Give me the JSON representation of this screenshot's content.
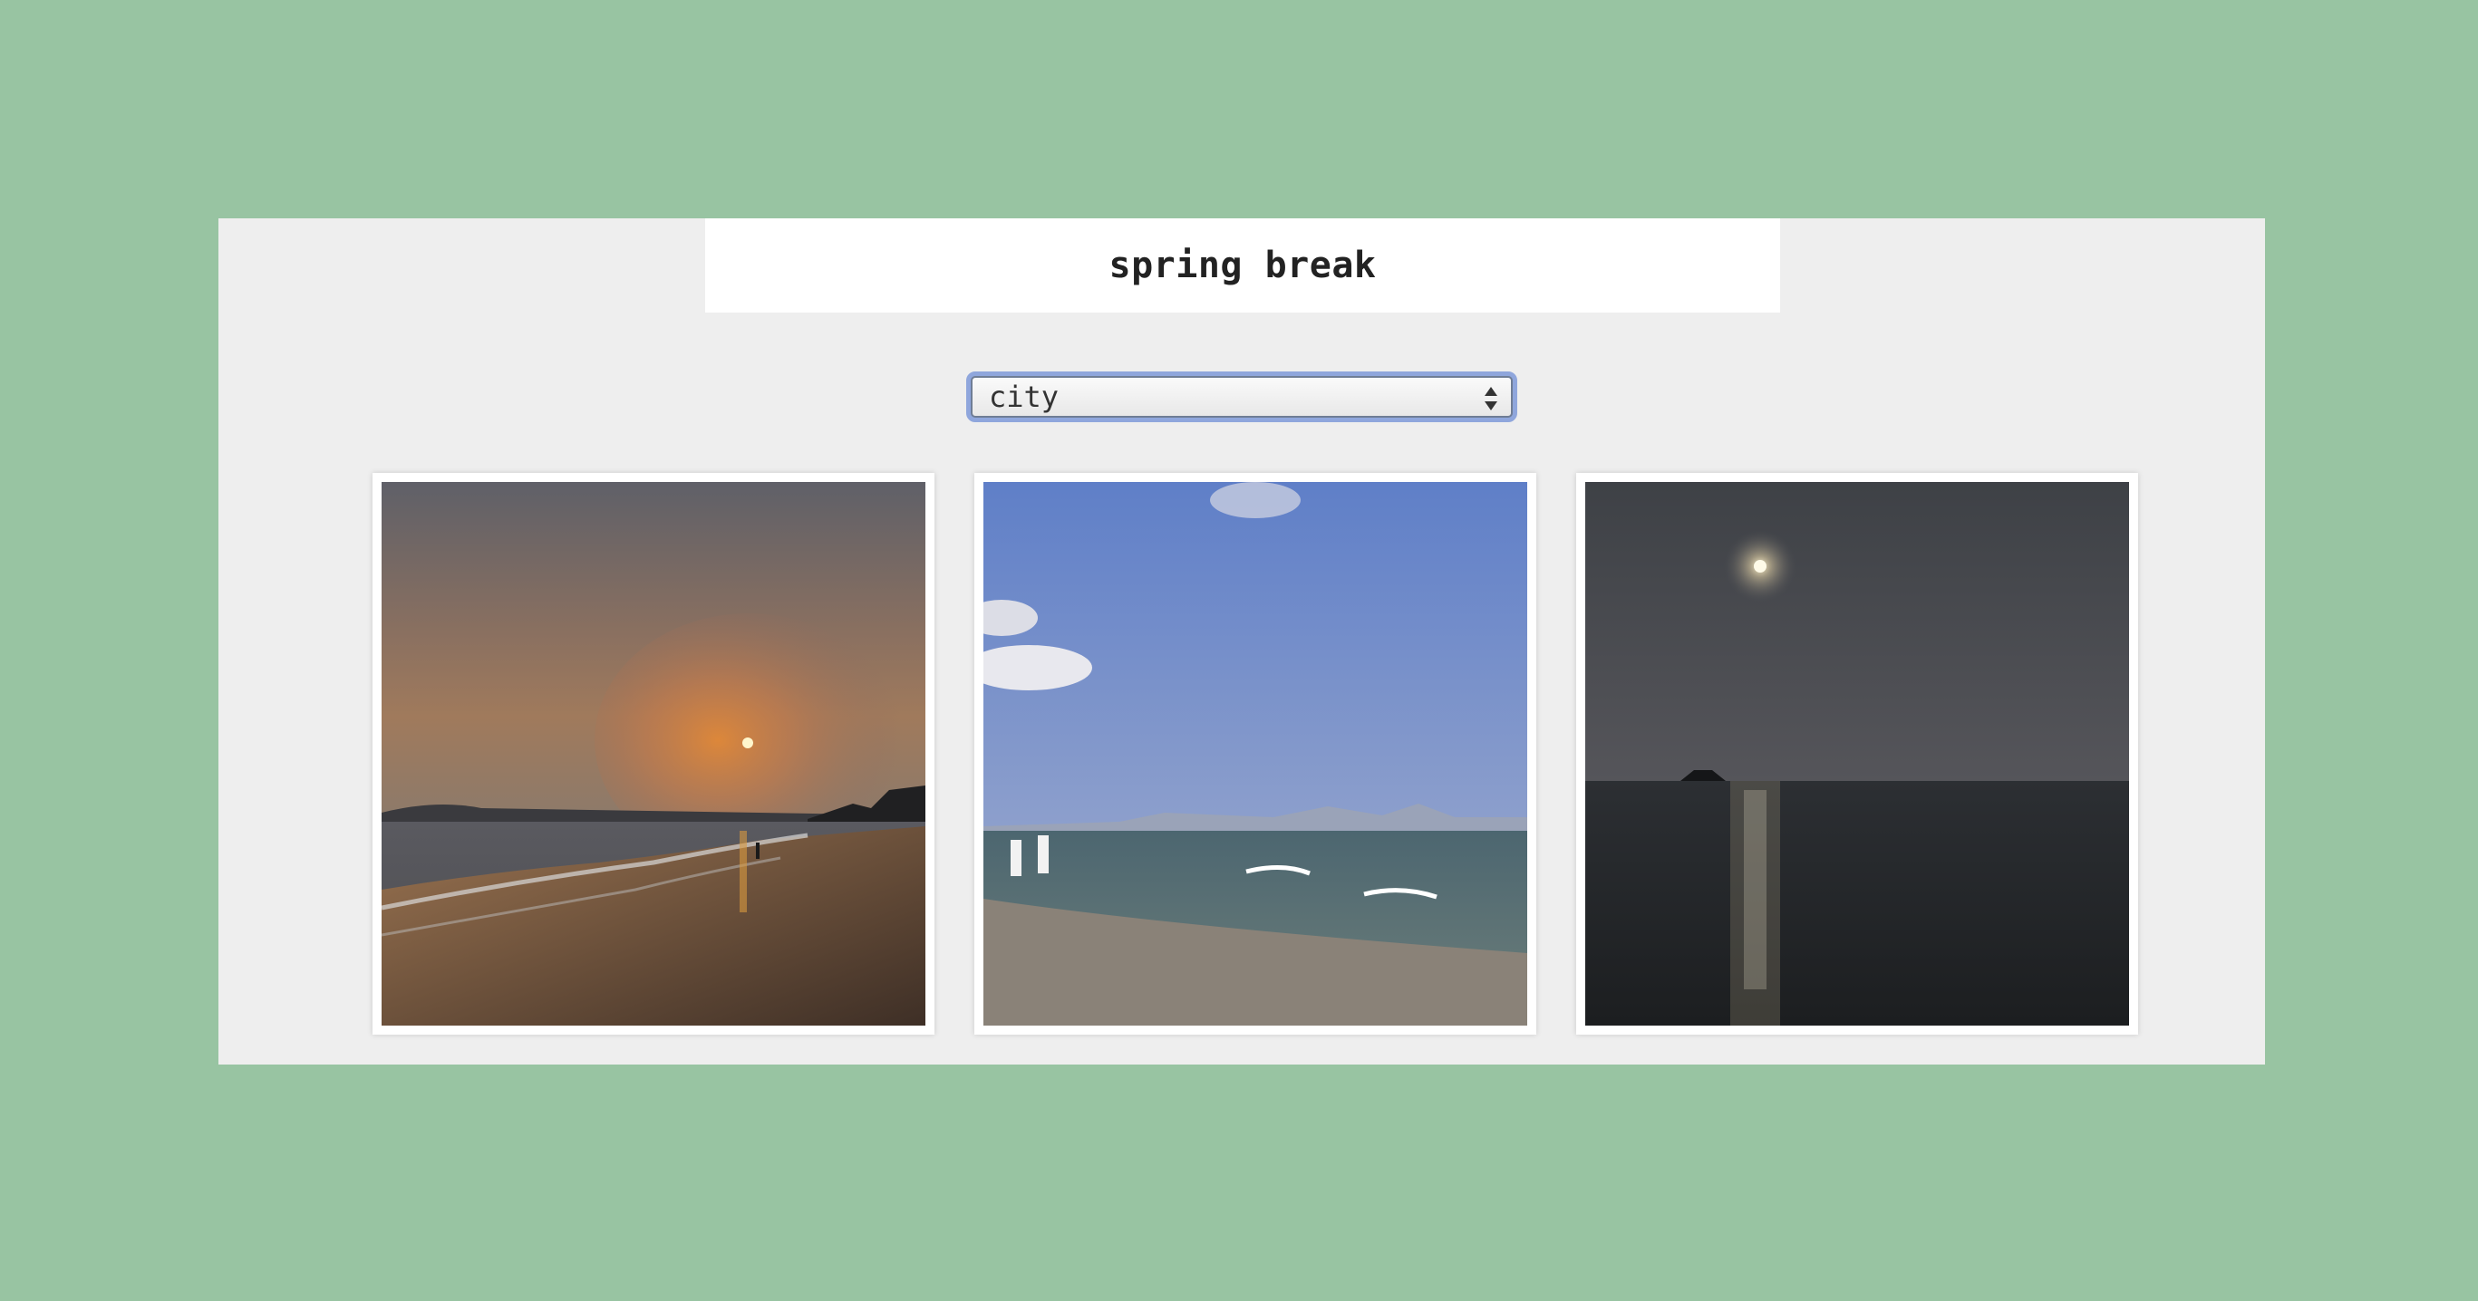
{
  "header": {
    "title": "spring break"
  },
  "filter": {
    "selected": "city"
  },
  "gallery": {
    "photos": [
      {
        "subject": "beach-sunset-photo"
      },
      {
        "subject": "beach-daytime-photo"
      },
      {
        "subject": "sea-moonlight-photo"
      }
    ]
  },
  "colors": {
    "background": "#98c4a2",
    "panel": "#eeeeee",
    "select_focus": "#8fa6dc"
  }
}
